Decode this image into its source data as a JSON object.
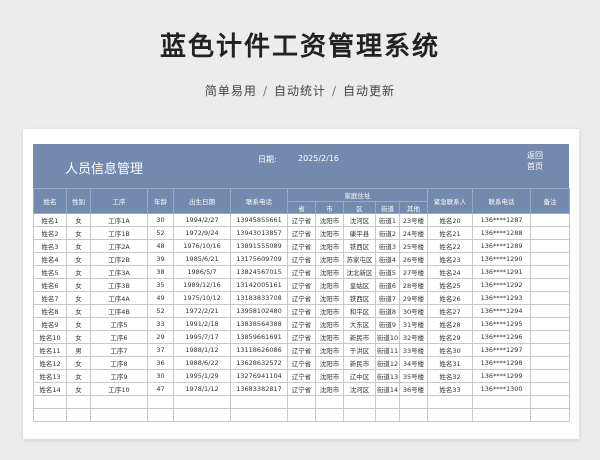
{
  "page": {
    "title": "蓝色计件工资管理系统",
    "subtitle": [
      "简单易用",
      "自动统计",
      "自动更新"
    ],
    "separator": "/"
  },
  "banner": {
    "heading": "人员信息管理",
    "date_label": "日期:",
    "date_value": "2025/2/16",
    "nav_back": "返回",
    "nav_home": "首页",
    "color": "#7389ae"
  },
  "table": {
    "headers": {
      "name": "姓名",
      "gender": "性别",
      "process": "工序",
      "age": "年龄",
      "birth": "出生日期",
      "phone": "联系电话",
      "address": "家庭住址",
      "emergency": "紧急联系人",
      "emergency_phone": "联系电话",
      "note": "备注",
      "province": "省",
      "city": "市",
      "district": "区",
      "street": "街道",
      "other": "其他"
    },
    "rows": [
      [
        "姓名1",
        "女",
        "工序1A",
        "30",
        "1994/2/27",
        "13945855661",
        "辽宁省",
        "沈阳市",
        "沈河区",
        "街道1",
        "23号楼",
        "姓名20",
        "136****1287",
        ""
      ],
      [
        "姓名2",
        "女",
        "工序1B",
        "52",
        "1972/9/24",
        "13943013857",
        "辽宁省",
        "沈阳市",
        "康平县",
        "街道2",
        "24号楼",
        "姓名21",
        "136****1288",
        ""
      ],
      [
        "姓名3",
        "女",
        "工序2A",
        "48",
        "1976/10/16",
        "13891555089",
        "辽宁省",
        "沈阳市",
        "铁西区",
        "街道3",
        "25号楼",
        "姓名22",
        "136****1289",
        ""
      ],
      [
        "姓名4",
        "女",
        "工序2B",
        "39",
        "1985/6/21",
        "13175609709",
        "辽宁省",
        "沈阳市",
        "苏家屯区",
        "街道4",
        "26号楼",
        "姓名23",
        "136****1290",
        ""
      ],
      [
        "姓名5",
        "女",
        "工序3A",
        "38",
        "1986/5/7",
        "13824567015",
        "辽宁省",
        "沈阳市",
        "沈北新区",
        "街道5",
        "27号楼",
        "姓名24",
        "136****1291",
        ""
      ],
      [
        "姓名6",
        "女",
        "工序3B",
        "35",
        "1989/12/16",
        "13142005161",
        "辽宁省",
        "沈阳市",
        "皇姑区",
        "街道6",
        "28号楼",
        "姓名25",
        "136****1292",
        ""
      ],
      [
        "姓名7",
        "女",
        "工序4A",
        "49",
        "1975/10/12",
        "13183833708",
        "辽宁省",
        "沈阳市",
        "铁西区",
        "街道7",
        "29号楼",
        "姓名26",
        "136****1293",
        ""
      ],
      [
        "姓名8",
        "女",
        "工序4B",
        "52",
        "1972/2/21",
        "13958102480",
        "辽宁省",
        "沈阳市",
        "和平区",
        "街道8",
        "30号楼",
        "姓名27",
        "136****1294",
        ""
      ],
      [
        "姓名9",
        "女",
        "工序5",
        "33",
        "1991/2/18",
        "13838564388",
        "辽宁省",
        "沈阳市",
        "大东区",
        "街道9",
        "31号楼",
        "姓名28",
        "136****1295",
        ""
      ],
      [
        "姓名10",
        "女",
        "工序6",
        "29",
        "1995/7/17",
        "13859661691",
        "辽宁省",
        "沈阳市",
        "新民市",
        "街道10",
        "32号楼",
        "姓名29",
        "136****1296",
        ""
      ],
      [
        "姓名11",
        "男",
        "工序7",
        "37",
        "1988/1/12",
        "13118626086",
        "辽宁省",
        "沈阳市",
        "于洪区",
        "街道11",
        "33号楼",
        "姓名30",
        "136****1297",
        ""
      ],
      [
        "姓名12",
        "女",
        "工序8",
        "36",
        "1988/6/22",
        "13628632572",
        "辽宁省",
        "沈阳市",
        "新民市",
        "街道12",
        "34号楼",
        "姓名31",
        "136****1298",
        ""
      ],
      [
        "姓名13",
        "女",
        "工序9",
        "30",
        "1995/1/29",
        "13276941104",
        "辽宁省",
        "沈阳市",
        "辽中区",
        "街道13",
        "35号楼",
        "姓名32",
        "136****1299",
        ""
      ],
      [
        "姓名14",
        "女",
        "工序10",
        "47",
        "1978/1/12",
        "13683382817",
        "辽宁省",
        "沈阳市",
        "沈河区",
        "街道14",
        "36号楼",
        "姓名33",
        "136****1300",
        ""
      ],
      [
        "",
        "",
        "",
        "",
        "",
        "",
        "",
        "",
        "",
        "",
        "",
        "",
        "",
        ""
      ],
      [
        "",
        "",
        "",
        "",
        "",
        "",
        "",
        "",
        "",
        "",
        "",
        "",
        "",
        ""
      ]
    ]
  }
}
